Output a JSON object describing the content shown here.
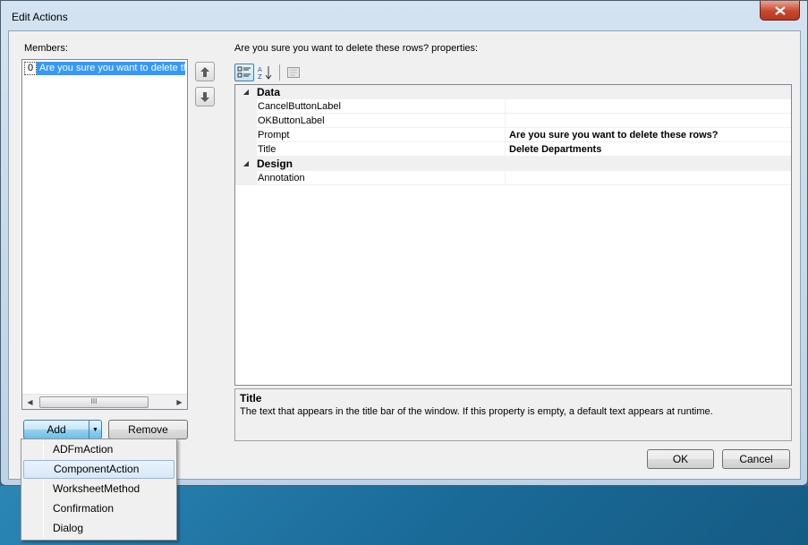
{
  "window": {
    "title": "Edit Actions"
  },
  "members": {
    "label": "Members:",
    "items": [
      {
        "index": "0",
        "text": "Are you sure you want to delete these rows?"
      }
    ],
    "scroll_thumb": "III"
  },
  "buttons": {
    "add": "Add",
    "remove": "Remove",
    "ok": "OK",
    "cancel": "Cancel"
  },
  "properties": {
    "label": "Are you sure you want to delete these rows? properties:",
    "categories": [
      {
        "name": "Data",
        "rows": [
          {
            "name": "CancelButtonLabel",
            "value": ""
          },
          {
            "name": "OKButtonLabel",
            "value": ""
          },
          {
            "name": "Prompt",
            "value": "Are you sure you want to delete these rows?"
          },
          {
            "name": "Title",
            "value": "Delete Departments"
          }
        ]
      },
      {
        "name": "Design",
        "rows": [
          {
            "name": "Annotation",
            "value": ""
          }
        ]
      }
    ]
  },
  "help": {
    "title": "Title",
    "description": "The text that appears in the title bar of the window. If this property is empty, a default text appears at runtime."
  },
  "add_menu": {
    "items": [
      "ADFmAction",
      "ComponentAction",
      "WorksheetMethod",
      "Confirmation",
      "Dialog"
    ],
    "selected": "ComponentAction"
  },
  "icons": {
    "close": "close-x-icon",
    "move_up": "arrow-up-icon",
    "move_down": "arrow-down-icon",
    "categorized": "categorized-icon",
    "alphabetical": "sort-alpha-icon",
    "property_pages": "property-pages-icon"
  },
  "colors": {
    "selection": "#3399ff",
    "close_button": "#c8462d",
    "desktop": "#1f6f9a"
  }
}
